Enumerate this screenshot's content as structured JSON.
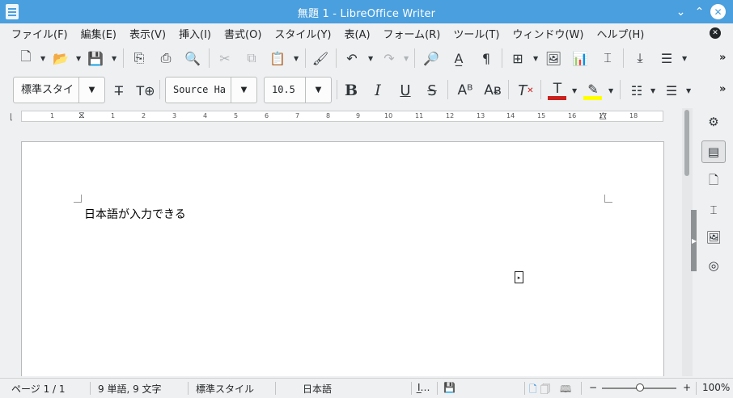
{
  "window": {
    "title": "無題 1 - LibreOffice Writer"
  },
  "menu": [
    "ファイル(F)",
    "編集(E)",
    "表示(V)",
    "挿入(I)",
    "書式(O)",
    "スタイル(Y)",
    "表(A)",
    "フォーム(R)",
    "ツール(T)",
    "ウィンドウ(W)",
    "ヘルプ(H)"
  ],
  "formatting": {
    "paragraph_style": "標準スタイ",
    "font_name": "Source Ha",
    "font_size": "10.5"
  },
  "ruler": {
    "ticks": [
      "1",
      "1",
      "2",
      "3",
      "4",
      "5",
      "6",
      "7",
      "8",
      "9",
      "10",
      "11",
      "12",
      "13",
      "14",
      "15",
      "16",
      "17",
      "18"
    ]
  },
  "document": {
    "text": "日本語が入力できる"
  },
  "status": {
    "page": "ページ 1 / 1",
    "words": "9 単語, 9 文字",
    "style": "標準スタイル",
    "language": "日本語",
    "zoom_percent": "100%",
    "zoom_level": 1.0
  },
  "colors": {
    "titlebar": "#4a9fde",
    "font_color": "#c9211e",
    "highlight": "#ffff00"
  }
}
